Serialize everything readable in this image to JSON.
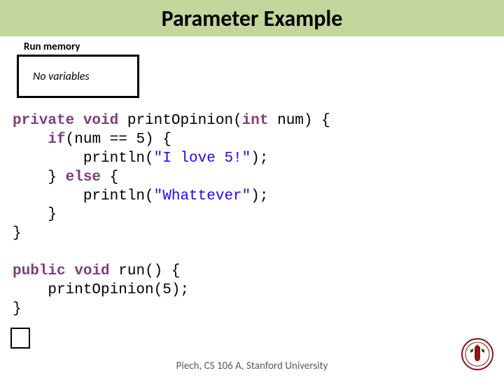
{
  "title": "Parameter Example",
  "run_memory_label": "Run memory",
  "memory_box_text": "No variables",
  "code": {
    "l1a": "private",
    "l1b": " ",
    "l1c": "void",
    "l1d": " printOpinion(",
    "l1e": "int",
    "l1f": " num) {",
    "l2a": "    ",
    "l2b": "if",
    "l2c": "(num == 5) {",
    "l3a": "        println(",
    "l3b": "\"I love 5!\"",
    "l3c": ");",
    "l4a": "    } ",
    "l4b": "else",
    "l4c": " {",
    "l5a": "        println(",
    "l5b": "\"Whattever\"",
    "l5c": ");",
    "l6": "    }",
    "l7": "}",
    "l8a": "public",
    "l8b": " ",
    "l8c": "void",
    "l8d": " run() {",
    "l9": "    printOpinion(5);",
    "l10": "}"
  },
  "footer": "Piech, CS 106 A, Stanford University",
  "logo_name": "stanford-seal"
}
